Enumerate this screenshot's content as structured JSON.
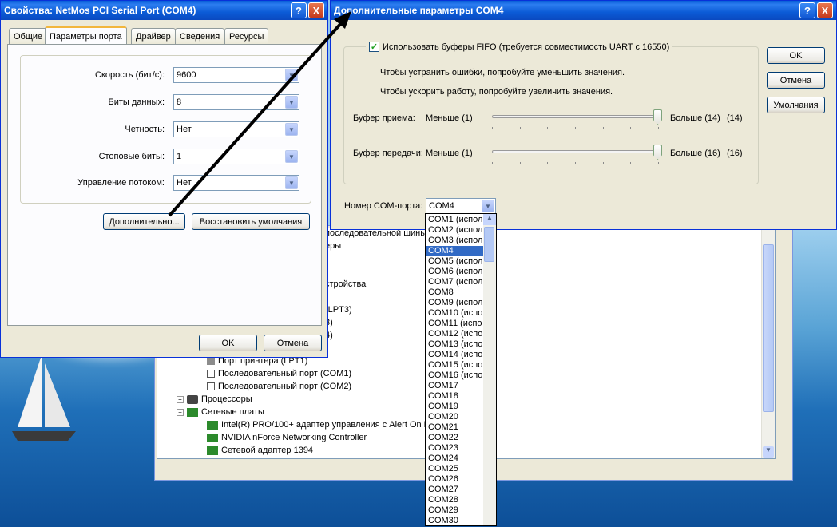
{
  "colors": {
    "accent": "#316ac5",
    "title_bar": "#0a5fd8",
    "dialog_bg": "#ece9d8"
  },
  "properties_dialog": {
    "title": "Свойства: NetMos PCI Serial Port (COM4)",
    "help_label": "?",
    "close_label": "X",
    "tabs": [
      "Общие",
      "Параметры порта",
      "Драйвер",
      "Сведения",
      "Ресурсы"
    ],
    "active_tab": "Параметры порта",
    "fields": [
      {
        "label": "Скорость (бит/с):",
        "value": "9600"
      },
      {
        "label": "Биты данных:",
        "value": "8"
      },
      {
        "label": "Четность:",
        "value": "Нет"
      },
      {
        "label": "Стоповые биты:",
        "value": "1"
      },
      {
        "label": "Управление потоком:",
        "value": "Нет"
      }
    ],
    "advanced_button": "Дополнительно...",
    "restore_button": "Восстановить умолчания",
    "ok_button": "OK",
    "cancel_button": "Отмена"
  },
  "advanced_dialog": {
    "title": "Дополнительные параметры COM4",
    "help_label": "?",
    "close_label": "X",
    "fifo_checkbox": "Использовать буферы FIFO (требуется совместимость UART с 16550)",
    "fifo_checked": true,
    "hint1": "Чтобы устранить ошибки, попробуйте уменьшить значения.",
    "hint2": "Чтобы ускорить работу, попробуйте увеличить значения.",
    "receive_label": "Буфер приема:",
    "receive_min": "Меньше (1)",
    "receive_max": "Больше (14)",
    "receive_value": "(14)",
    "receive_level": 1.0,
    "transmit_label": "Буфер передачи:",
    "transmit_min": "Меньше (1)",
    "transmit_max": "Больше (16)",
    "transmit_value": "(16)",
    "transmit_level": 1.0,
    "com_label": "Номер COM-порта:",
    "com_value": "COM4",
    "ok_button": "OK",
    "cancel_button": "Отмена",
    "defaults_button": "Умолчания"
  },
  "com_dropdown": {
    "selected": "COM4",
    "items": [
      "COM1 (испол",
      "COM2 (испол",
      "COM3 (испол",
      "COM4",
      "COM5 (испол",
      "COM6 (испол",
      "COM7 (испол",
      "COM8",
      "COM9 (испол",
      "COM10 (испо",
      "COM11 (испо",
      "COM12 (испо",
      "COM13 (испо",
      "COM14 (испо",
      "COM15 (испо",
      "COM16 (испо",
      "COM17",
      "COM18",
      "COM19",
      "COM20",
      "COM21",
      "COM22",
      "COM23",
      "COM24",
      "COM25",
      "COM26",
      "COM27",
      "COM28",
      "COM29",
      "COM30"
    ]
  },
  "device_manager": {
    "partial_lines": [
      "последовательной шины",
      "еры",
      "стройства",
      "(LPT3)",
      "3)",
      "4)"
    ],
    "lines": [
      "Порт принтера (LPT1)",
      "Последовательный порт (COM1)",
      "Последовательный порт (COM2)",
      "Процессоры",
      "Сетевые платы",
      "Intel(R) PRO/100+ адаптер управления с Alert On L",
      "NVIDIA nForce Networking Controller",
      "Сетевой адаптер 1394"
    ],
    "plus_sign": "+",
    "minus_sign": "−"
  }
}
